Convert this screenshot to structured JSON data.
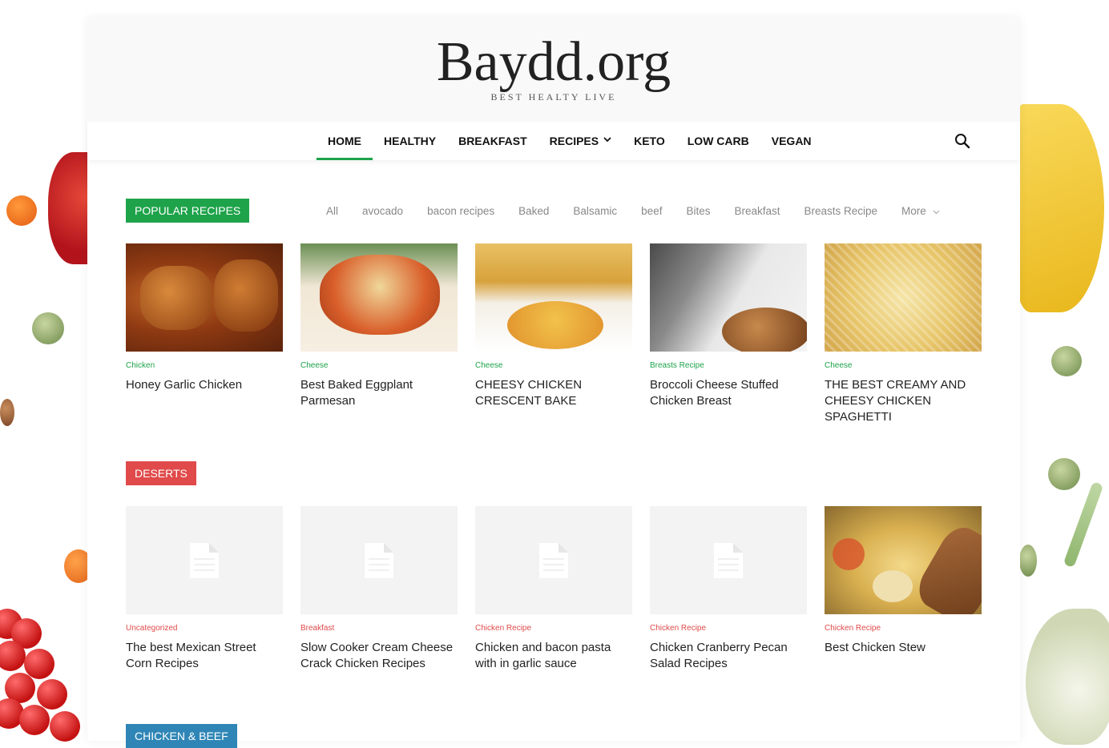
{
  "site": {
    "title": "Baydd.org",
    "tagline": "BEST HEALTY LIVE"
  },
  "nav": {
    "items": [
      {
        "label": "HOME",
        "active": true
      },
      {
        "label": "HEALTHY"
      },
      {
        "label": "BREAKFAST"
      },
      {
        "label": "RECIPES",
        "has_dropdown": true
      },
      {
        "label": "KETO"
      },
      {
        "label": "LOW CARB"
      },
      {
        "label": "VEGAN"
      }
    ],
    "search_icon": "search-icon",
    "accent": "#1ea34a"
  },
  "popular": {
    "label": "POPULAR RECIPES",
    "label_color": "#1ea34a",
    "category_color": "#1ea34a",
    "filters": [
      "All",
      "avocado",
      "bacon recipes",
      "Baked",
      "Balsamic",
      "beef",
      "Bites",
      "Breakfast",
      "Breasts Recipe",
      "More"
    ],
    "posts": [
      {
        "category": "Chicken",
        "title": "Honey Garlic Chicken"
      },
      {
        "category": "Cheese",
        "title": "Best Baked Eggplant Parmesan"
      },
      {
        "category": "Cheese",
        "title": "CHEESY CHICKEN CRESCENT BAKE"
      },
      {
        "category": "Breasts Recipe",
        "title": "Broccoli Cheese Stuffed Chicken Breast"
      },
      {
        "category": "Cheese",
        "title": "THE BEST CREAMY AND CHEESY CHICKEN SPAGHETTI"
      }
    ]
  },
  "deserts": {
    "label": "DESERTS",
    "label_color": "#e04a4a",
    "category_color": "#e04a4a",
    "posts": [
      {
        "category": "Uncategorized",
        "title": "The best Mexican Street Corn Recipes"
      },
      {
        "category": "Breakfast",
        "title": "Slow Cooker Cream Cheese Crack Chicken Recipes"
      },
      {
        "category": "Chicken Recipe",
        "title": "Chicken and bacon pasta with in garlic sauce"
      },
      {
        "category": "Chicken Recipe",
        "title": "Chicken Cranberry Pecan Salad Recipes"
      },
      {
        "category": "Chicken Recipe",
        "title": "Best Chicken Stew"
      }
    ]
  },
  "chicken_beef": {
    "label": "CHICKEN & BEEF",
    "label_color": "#2f86b6"
  }
}
